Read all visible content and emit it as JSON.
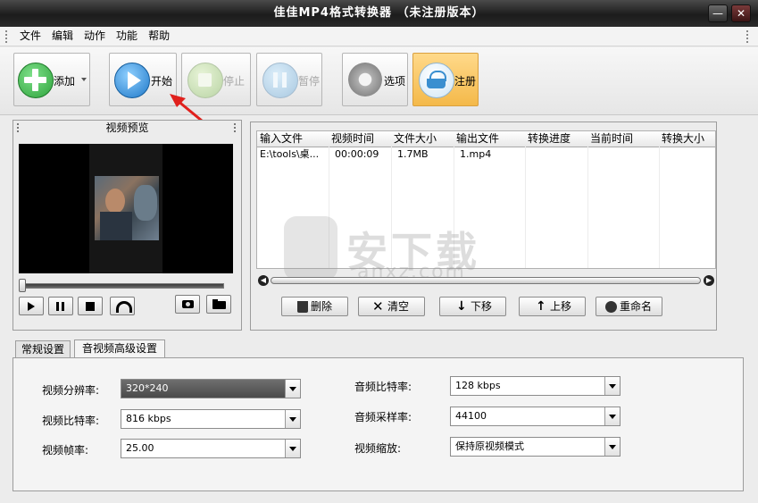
{
  "window": {
    "title": "佳佳MP4格式转换器  （未注册版本）",
    "min_label": "—",
    "close_label": "✕"
  },
  "menu": [
    "文件",
    "编辑",
    "动作",
    "功能",
    "帮助"
  ],
  "toolbar": {
    "add": "添加",
    "start": "开始",
    "stop": "停止",
    "pause": "暂停",
    "options": "选项",
    "register": "注册"
  },
  "preview": {
    "title": "视频预览"
  },
  "table": {
    "headers": [
      "输入文件",
      "视频时间",
      "文件大小",
      "输出文件",
      "转换进度",
      "当前时间",
      "转换大小"
    ],
    "rows": [
      [
        "E:\\tools\\桌...",
        "00:00:09",
        "1.7MB",
        "1.mp4",
        "",
        "",
        ""
      ]
    ]
  },
  "actions": {
    "delete": "删除",
    "clear": "清空",
    "down": "下移",
    "up": "上移",
    "rename": "重命名"
  },
  "tabs": [
    "常规设置",
    "音视频高级设置"
  ],
  "settings": {
    "resolution_label": "视频分辨率:",
    "resolution_value": "320*240",
    "vbitrate_label": "视频比特率:",
    "vbitrate_value": "816 kbps",
    "framerate_label": "视频帧率:",
    "framerate_value": "25.00",
    "abitrate_label": "音频比特率:",
    "abitrate_value": "128 kbps",
    "samplerate_label": "音频采样率:",
    "samplerate_value": "44100",
    "scale_label": "视频缩放:",
    "scale_value": "保持原视频模式"
  },
  "watermark": {
    "brand": "安下载",
    "domain": "anxz.com"
  },
  "colors": {
    "add_green": "#3bb54a",
    "start_blue": "#2f8fd8",
    "register_orange": "#f4b94a",
    "arrow_red": "#e0201c"
  }
}
